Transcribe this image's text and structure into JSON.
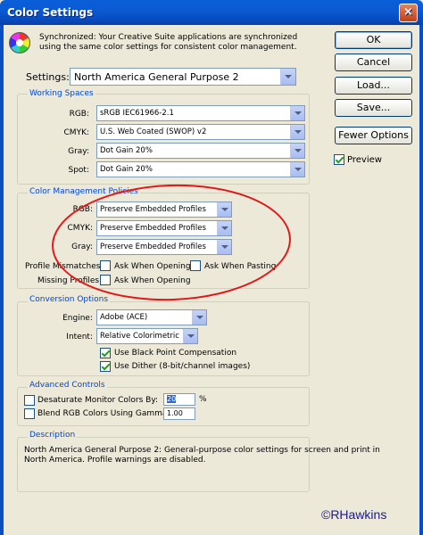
{
  "window": {
    "title": "Color Settings",
    "close_label": "×"
  },
  "sync_message": "Synchronized: Your Creative Suite applications are synchronized using the same color settings for consistent color management.",
  "settings": {
    "label": "Settings:",
    "value": "North America General Purpose 2"
  },
  "working_spaces": {
    "title": "Working Spaces",
    "rgb_label": "RGB:",
    "rgb_value": "sRGB IEC61966-2.1",
    "cmyk_label": "CMYK:",
    "cmyk_value": "U.S. Web Coated (SWOP) v2",
    "gray_label": "Gray:",
    "gray_value": "Dot Gain 20%",
    "spot_label": "Spot:",
    "spot_value": "Dot Gain 20%"
  },
  "policies": {
    "title": "Color Management Policies",
    "rgb_label": "RGB:",
    "rgb_value": "Preserve Embedded Profiles",
    "cmyk_label": "CMYK:",
    "cmyk_value": "Preserve Embedded Profiles",
    "gray_label": "Gray:",
    "gray_value": "Preserve Embedded Profiles",
    "mismatch_label": "Profile Mismatches:",
    "ask_opening": "Ask When Opening",
    "ask_opening_checked": false,
    "ask_pasting": "Ask When Pasting",
    "ask_pasting_checked": false,
    "missing_label": "Missing Profiles:",
    "missing_ask_opening": "Ask When Opening",
    "missing_ask_opening_checked": false
  },
  "conversion": {
    "title": "Conversion Options",
    "engine_label": "Engine:",
    "engine_value": "Adobe (ACE)",
    "intent_label": "Intent:",
    "intent_value": "Relative Colorimetric",
    "black_point": "Use Black Point Compensation",
    "black_point_checked": true,
    "dither": "Use Dither (8-bit/channel images)",
    "dither_checked": true
  },
  "advanced": {
    "title": "Advanced Controls",
    "desaturate": "Desaturate Monitor Colors By:",
    "desaturate_checked": false,
    "desaturate_value": "20",
    "desaturate_unit": "%",
    "blend": "Blend RGB Colors Using Gamma:",
    "blend_checked": false,
    "blend_value": "1.00"
  },
  "description": {
    "title": "Description",
    "text": "North America General Purpose 2:  General-purpose color settings for screen and print in North America. Profile warnings are disabled."
  },
  "buttons": {
    "ok": "OK",
    "cancel": "Cancel",
    "load": "Load...",
    "save": "Save...",
    "fewer_options": "Fewer Options",
    "preview": "Preview",
    "preview_checked": true
  },
  "watermark": "©RHawkins",
  "colors": {
    "title_bar": "#0a5fd8",
    "group_title": "#0046d5",
    "highlight_ellipse": "#e01818"
  }
}
